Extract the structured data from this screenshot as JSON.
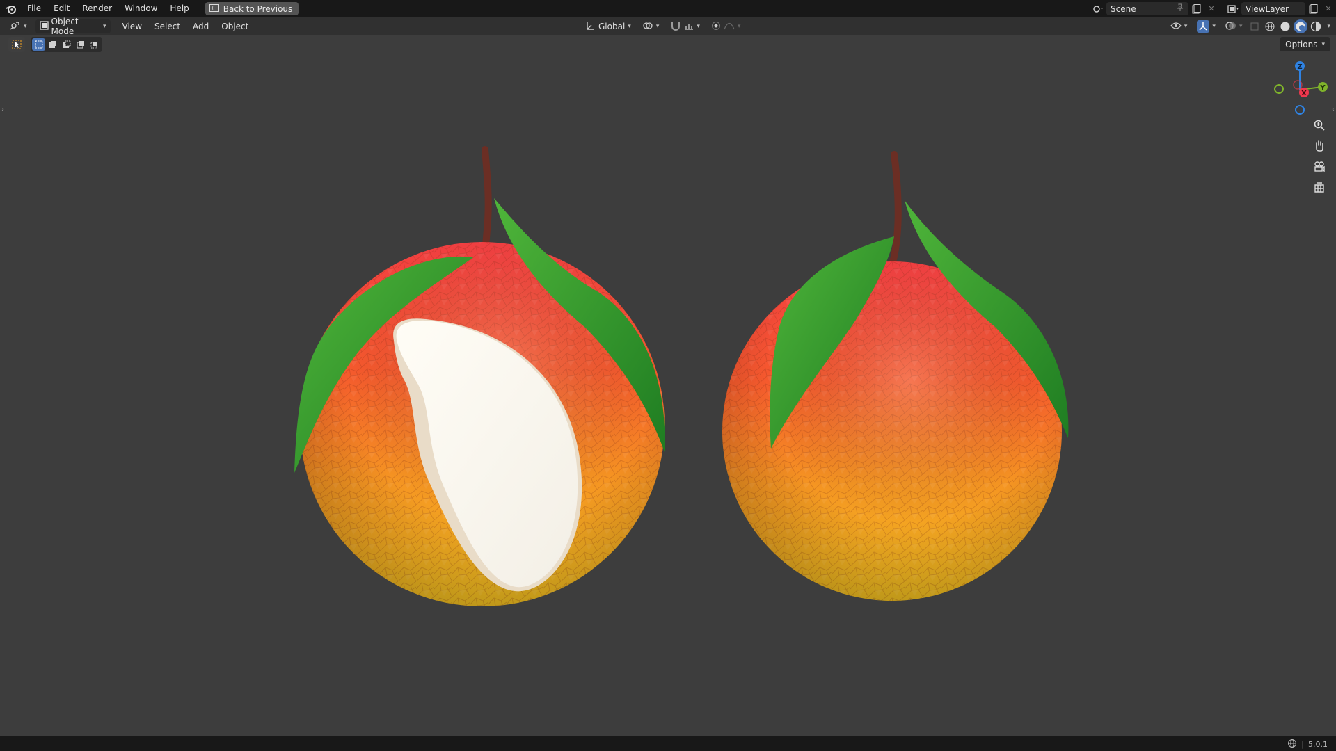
{
  "topbar": {
    "menus": [
      "File",
      "Edit",
      "Render",
      "Window",
      "Help"
    ],
    "back_button": "Back to Previous",
    "scene_label": "Scene",
    "view_layer_label": "ViewLayer"
  },
  "header": {
    "mode_label": "Object Mode",
    "menus": [
      "View",
      "Select",
      "Add",
      "Object"
    ],
    "orientation_label": "Global",
    "options_label": "Options"
  },
  "gizmo": {
    "axis_z": "Z",
    "axis_x": "X",
    "axis_y": "Y"
  },
  "status": {
    "version": "5.0.1"
  },
  "colors": {
    "accent": "#4772b3",
    "axis_x": "#f0384e",
    "axis_y": "#7fb32b",
    "axis_z": "#2f83e3"
  },
  "icons": {
    "app": "blender-logo-icon",
    "zoom": "zoom-icon",
    "pan": "hand-icon",
    "camera": "camera-icon",
    "grid": "grid-icon"
  }
}
